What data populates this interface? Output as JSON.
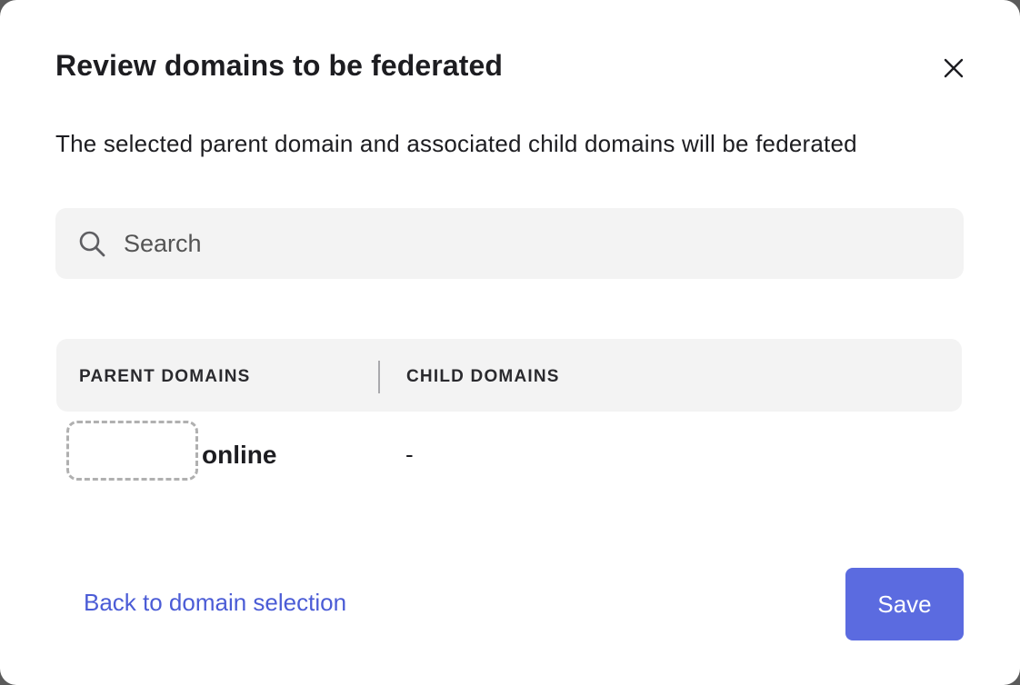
{
  "dialog": {
    "title": "Review domains to be federated",
    "close_icon": "close-icon",
    "description": "The selected parent domain and associated child domains will be federated"
  },
  "search": {
    "icon": "search-icon",
    "placeholder": "Search",
    "value": ""
  },
  "table": {
    "columns": [
      "PARENT DOMAINS",
      "CHILD DOMAINS"
    ],
    "rows": [
      {
        "parent_domain": "online",
        "child_domains": "-"
      }
    ]
  },
  "footer": {
    "back_label": "Back to domain selection",
    "save_label": "Save"
  },
  "colors": {
    "accent": "#5b6be0",
    "link": "#4b5cd6",
    "panel_bg": "#f3f3f3"
  }
}
